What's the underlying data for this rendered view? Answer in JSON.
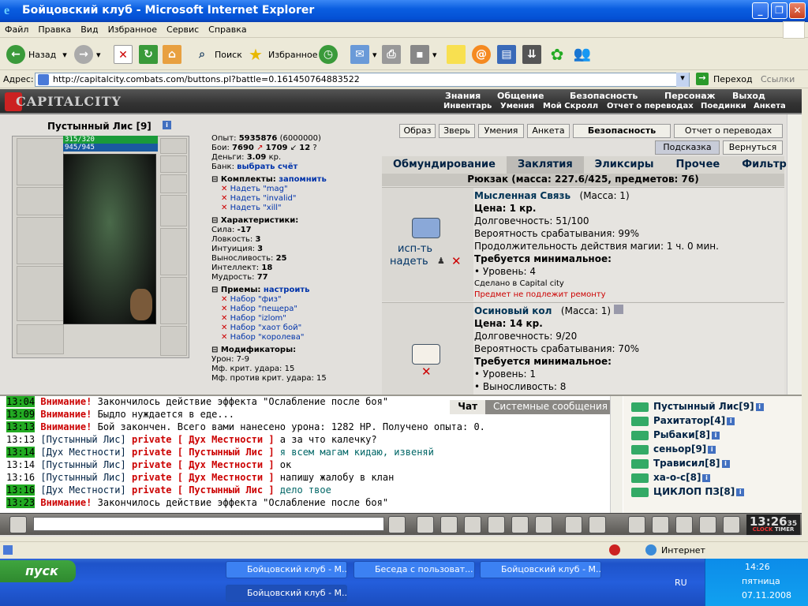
{
  "window": {
    "title": "Бойцовский клуб - Microsoft Internet Explorer"
  },
  "menu": [
    "Файл",
    "Правка",
    "Вид",
    "Избранное",
    "Сервис",
    "Справка"
  ],
  "toolbar": {
    "back": "Назад",
    "search": "Поиск",
    "favorites": "Избранное"
  },
  "address": {
    "label": "Адрес:",
    "url": "http://capitalcity.combats.com/buttons.pl?battle=0.161450764883522",
    "go": "Переход",
    "links": "Ссылки"
  },
  "game": {
    "logo": "CAPITALCITY",
    "top_menu": [
      "Знания",
      "Общение",
      "Безопасность",
      "Персонаж",
      "Выход"
    ],
    "sub_menu": [
      "Инвентарь",
      "Умения",
      "Мой Скролл",
      "Отчет о переводах",
      "Поединки",
      "Анкета"
    ],
    "char": {
      "name": "Пустынный Лис [9]",
      "hp": "315/320",
      "mp": "945/945"
    },
    "stats": {
      "exp_label": "Опыт:",
      "exp": "5935876",
      "exp_next": "(6000000)",
      "fights_label": "Бои:",
      "fights_win": "7690",
      "fights_lose": "1709",
      "fights_draw": "12",
      "money_label": "Деньги:",
      "money": "3.09",
      "money_unit": "кр.",
      "bank_label": "Банк:",
      "bank_link": "выбрать счёт",
      "sets_label": "Комплекты:",
      "remember": "запомнить",
      "sets": [
        "Надеть \"mag\"",
        "Надеть \"invalid\"",
        "Надеть \"xill\""
      ],
      "chars_label": "Характеристики:",
      "attrs": [
        [
          "Сила:",
          "-17"
        ],
        [
          "Ловкость:",
          "3"
        ],
        [
          "Интуиция:",
          "3"
        ],
        [
          "Выносливость:",
          "25"
        ],
        [
          "Интеллект:",
          "18"
        ],
        [
          "Мудрость:",
          "77"
        ]
      ],
      "tricks_label": "Приемы:",
      "setup": "настроить",
      "tricks": [
        "Набор \"физ\"",
        "Набор \"пещера\"",
        "Набор \"izlom\"",
        "Набор \"хаот бой\"",
        "Набор \"королева\""
      ],
      "mods_label": "Модификаторы:",
      "mods": [
        "Урон: 7-9",
        "Мф. крит. удара: 15",
        "Мф. против крит. удара: 15"
      ]
    },
    "right_buttons": [
      "Образ",
      "Зверь",
      "Умения",
      "Анкета",
      "Безопасность",
      "Отчет о переводах"
    ],
    "hint": "Подсказка",
    "back": "Вернуться",
    "tabs": [
      "Обмундирование",
      "Заклятия",
      "Эликсиры",
      "Прочее",
      "Фильтр"
    ],
    "pack": "Рюкзак (масса: 227.6/425, предметов: 76)",
    "items": [
      {
        "name": "Мысленная Связь",
        "mass": "(Масса: 1)",
        "price": "Цена: 1 кр.",
        "dur": "Долговечность: 51/100",
        "prob": "Вероятность срабатывания: 99%",
        "duration": "Продолжительность действия магии: 1 ч. 0 мин.",
        "req": "Требуется минимальное:",
        "req1": "• Уровень: 4",
        "made": "Сделано в Capital city",
        "norepair": "Предмет не подлежит ремонту",
        "use": "исп-ть",
        "wear": "надеть"
      },
      {
        "name": "Осиновый кол",
        "mass": "(Масса: 1)",
        "price": "Цена: 14 кр.",
        "dur": "Долговечность: 9/20",
        "prob": "Вероятность срабатывания: 70%",
        "req": "Требуется минимальное:",
        "req1": "• Уровень: 1",
        "req2": "• Выносливость: 8"
      }
    ],
    "chat_tabs": [
      "Чат",
      "Системные сообщения"
    ],
    "chat": [
      {
        "time": "13:04",
        "parts": [
          [
            "red",
            "Внимание!"
          ],
          [
            "t",
            " Закончилось действие эффекта \"Ослабление после боя\""
          ]
        ]
      },
      {
        "time": "13:09",
        "parts": [
          [
            "red",
            "Внимание!"
          ],
          [
            "t",
            " Быдло нуждается в еде..."
          ]
        ]
      },
      {
        "time": "13:13",
        "parts": [
          [
            "red",
            "Внимание!"
          ],
          [
            "t",
            " Бой закончен. Всего вами нанесено урона: 1282 HP. Получено опыта: 0."
          ]
        ]
      },
      {
        "time": "13:13",
        "parts": [
          [
            "nick",
            "[Пустынный Лис]"
          ],
          [
            "red",
            " private [ Дух Местности ]"
          ],
          [
            "t",
            " а за что калечку?"
          ]
        ]
      },
      {
        "time": "13:14",
        "parts": [
          [
            "nick",
            "[Дух Местности]"
          ],
          [
            "red",
            " private [ Пустынный Лис ]"
          ],
          [
            "grn",
            " я всем магам кидаю, извеняй"
          ]
        ]
      },
      {
        "time": "13:14",
        "parts": [
          [
            "nick",
            "[Пустынный Лис]"
          ],
          [
            "red",
            " private [ Дух Местности ]"
          ],
          [
            "t",
            " ок"
          ]
        ]
      },
      {
        "time": "13:16",
        "parts": [
          [
            "nick",
            "[Пустынный Лис]"
          ],
          [
            "red",
            " private [ Дух Местности ]"
          ],
          [
            "t",
            " напишу жалобу в клан"
          ]
        ]
      },
      {
        "time": "13:16",
        "parts": [
          [
            "nick",
            "[Дух Местности]"
          ],
          [
            "red",
            " private [ Пустынный Лис ]"
          ],
          [
            "grn",
            " дело твое"
          ]
        ]
      },
      {
        "time": "13:23",
        "parts": [
          [
            "red",
            "Внимание!"
          ],
          [
            "t",
            " Закончилось действие эффекта \"Ослабление после боя\""
          ]
        ]
      }
    ],
    "online": [
      "Пустынный Лис[9]",
      "Рахитатор[4]",
      "Рыбаки[8]",
      "сеньор[9]",
      "Трависил[8]",
      "ха-о-с[8]",
      "ЦИКЛОП ПЗ[8]"
    ],
    "clock": "13:26",
    "clock_sec": "35",
    "clock_label": "CLOCK",
    "timer_label": "TIMER"
  },
  "statusbar": {
    "zone": "Интернет"
  },
  "taskbar": {
    "start": "пуск",
    "tasks": [
      "Бойцовский клуб - М...",
      "Беседа с пользоват...",
      "Бойцовский клуб - М...",
      "Бойцовский клуб - М..."
    ],
    "lang": "RU",
    "time": "14:26",
    "day": "пятница",
    "date": "07.11.2008"
  }
}
